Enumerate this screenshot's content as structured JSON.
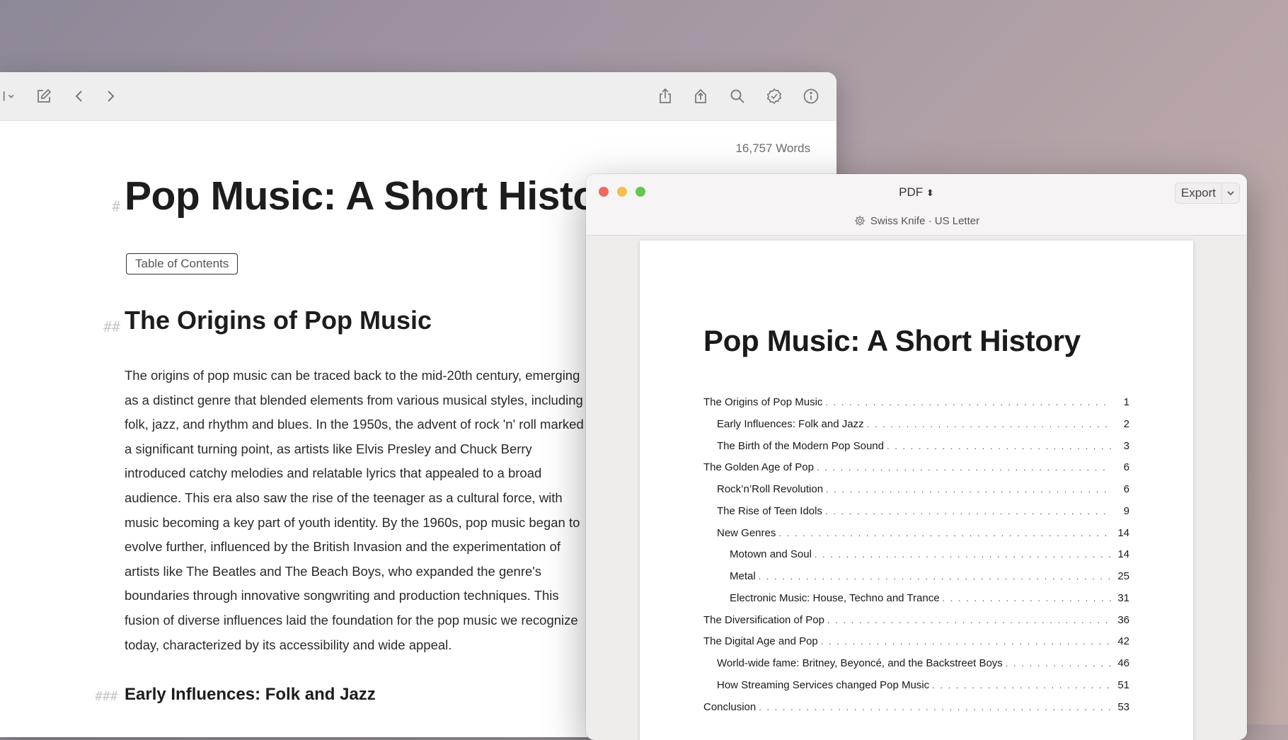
{
  "editor": {
    "word_count": "16,757 Words",
    "title": "Pop Music: A Short History",
    "title_marker": "#",
    "toc_label": "Table of Contents",
    "h2": "The Origins of Pop Music",
    "h2_marker": "##",
    "paragraph_lines": [
      "The origins of pop music can be traced back to the mid-20th century, emerging",
      "as a distinct genre that blended elements from various musical styles, including",
      "folk, jazz, and rhythm and blues. In the 1950s, the advent of rock 'n' roll marked",
      "a significant turning point, as artists like Elvis Presley and Chuck Berry",
      "introduced catchy melodies and relatable lyrics that appealed to a broad",
      "audience. This era also saw the rise of the teenager as a cultural force, with",
      "music becoming a key part of youth identity. By the 1960s, pop music began to",
      "evolve further, influenced by the British Invasion and the experimentation of",
      "artists like The Beatles and The Beach Boys, who expanded the genre's",
      "boundaries through innovative songwriting and production techniques. This",
      "fusion of diverse influences laid the foundation for the pop music we recognize",
      "today, characterized by its accessibility and wide appeal."
    ],
    "h3": "Early Influences: Folk and Jazz",
    "h3_marker": "###",
    "toolbar_icons": [
      "chevron-down-icon",
      "compose-icon",
      "back-icon",
      "forward-icon",
      "share-icon",
      "publish-icon",
      "search-icon",
      "checkmark-seal-icon",
      "info-icon"
    ]
  },
  "preview": {
    "format": "PDF",
    "export_label": "Export",
    "template": "Swiss Knife · US Letter",
    "page_title": "Pop Music: A Short History",
    "toc": [
      {
        "label": "The Origins of Pop Music",
        "page": "1",
        "level": 1
      },
      {
        "label": "Early Influences: Folk and Jazz",
        "page": "2",
        "level": 2
      },
      {
        "label": "The Birth of the Modern Pop Sound",
        "page": "3",
        "level": 2
      },
      {
        "label": "The Golden Age of Pop",
        "page": "6",
        "level": 1
      },
      {
        "label": "Rock’n’Roll Revolution",
        "page": "6",
        "level": 2
      },
      {
        "label": "The Rise of Teen Idols",
        "page": "9",
        "level": 2
      },
      {
        "label": "New Genres",
        "page": "14",
        "level": 2
      },
      {
        "label": "Motown and Soul",
        "page": "14",
        "level": 3
      },
      {
        "label": "Metal",
        "page": "25",
        "level": 3
      },
      {
        "label": "Electronic Music: House, Techno and Trance",
        "page": "31",
        "level": 3
      },
      {
        "label": "The Diversification of Pop",
        "page": "36",
        "level": 1
      },
      {
        "label": "The Digital Age and Pop",
        "page": "42",
        "level": 1
      },
      {
        "label": "World-wide fame: Britney, Beyoncé, and the Backstreet Boys",
        "page": "46",
        "level": 2
      },
      {
        "label": "How Streaming Services changed Pop Music",
        "page": "51",
        "level": 2
      },
      {
        "label": "Conclusion",
        "page": "53",
        "level": 1
      }
    ]
  },
  "colors": {
    "traffic_close": "#ed6a5e",
    "traffic_minimize": "#f5bf4f",
    "traffic_zoom": "#62c554"
  }
}
